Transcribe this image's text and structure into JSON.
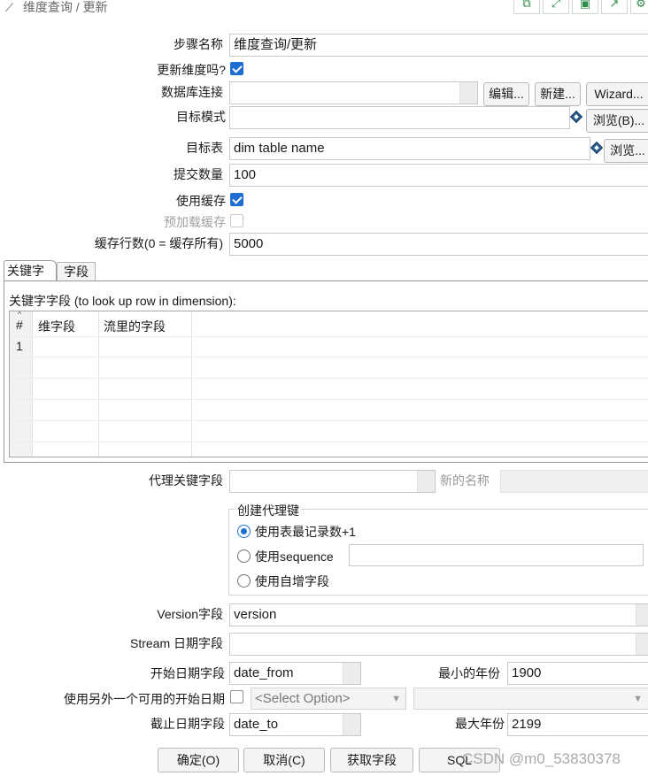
{
  "window": {
    "title": "维度查询 / 更新"
  },
  "toolbar": {
    "icons": [
      "copy-icon",
      "expand-icon",
      "save-icon",
      "export-icon",
      "gear-icon"
    ]
  },
  "form": {
    "step_name_label": "步骤名称",
    "step_name_value": "维度查询/更新",
    "update_dim_label": "更新维度吗?",
    "update_dim_checked": true,
    "db_conn_label": "数据库连接",
    "db_conn_value": "",
    "edit_btn": "编辑...",
    "new_btn": "新建...",
    "wizard_btn": "Wizard...",
    "schema_label": "目标模式",
    "schema_value": "",
    "browse_schema_btn": "浏览(B)...",
    "table_label": "目标表",
    "table_value": "dim table name",
    "browse_table_btn": "浏览...",
    "commit_label": "提交数量",
    "commit_value": "100",
    "use_cache_label": "使用缓存",
    "use_cache_checked": true,
    "preload_label": "预加载缓存",
    "preload_checked": false,
    "cache_rows_label": "缓存行数(0 = 缓存所有)",
    "cache_rows_value": "5000"
  },
  "tabs": [
    {
      "label": "关键字",
      "active": true
    },
    {
      "label": "字段",
      "active": false
    }
  ],
  "keys_panel": {
    "caption": "关键字字段 (to look up row in dimension):",
    "columns": [
      "#",
      "维字段",
      "流里的字段"
    ],
    "rows": [
      {
        "num": "1",
        "dim_field": "",
        "stream_field": ""
      }
    ]
  },
  "tech_key": {
    "label": "代理关键字段",
    "value": "",
    "new_name_label": "新的名称",
    "new_name_value": ""
  },
  "create_key": {
    "group_label": "创建代理键",
    "options": [
      "使用表最记录数+1",
      "使用sequence",
      "使用自增字段"
    ],
    "selected": 0,
    "sequence_value": ""
  },
  "version": {
    "label": "Version字段",
    "value": "version"
  },
  "stream_date": {
    "label": "Stream 日期字段",
    "value": ""
  },
  "date_from": {
    "label": "开始日期字段",
    "value": "date_from",
    "min_year_label": "最小的年份",
    "min_year_value": "1900"
  },
  "alt_start": {
    "label": "使用另外一个可用的开始日期",
    "checked": false,
    "select_placeholder": "<Select Option>",
    "second_value": ""
  },
  "date_to": {
    "label": "截止日期字段",
    "value": "date_to",
    "max_year_label": "最大年份",
    "max_year_value": "2199"
  },
  "buttons": {
    "ok": "确定(O)",
    "cancel": "取消(C)",
    "get_fields": "获取字段",
    "sql": "SQL"
  },
  "watermark": "CSDN @m0_53830378"
}
